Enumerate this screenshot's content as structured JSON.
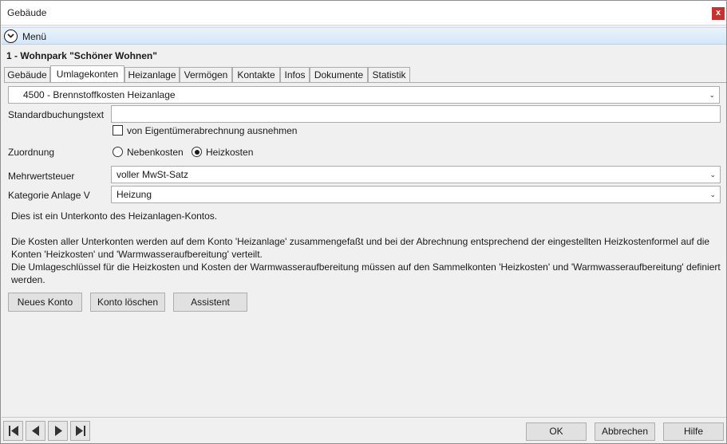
{
  "window": {
    "title": "Gebäude",
    "close_label": "x"
  },
  "menu": {
    "label": "Menü"
  },
  "record": {
    "title": "1 - Wohnpark \"Schöner Wohnen\""
  },
  "tabs": [
    {
      "label": "Gebäude"
    },
    {
      "label": "Umlagekonten"
    },
    {
      "label": "Heizanlage"
    },
    {
      "label": "Vermögen"
    },
    {
      "label": "Kontakte"
    },
    {
      "label": "Infos"
    },
    {
      "label": "Dokumente"
    },
    {
      "label": "Statistik"
    }
  ],
  "active_tab": "Umlagekonten",
  "form": {
    "account_select": "4500 - Brennstoffkosten Heizanlage",
    "standard_text_label": "Standardbuchungstext",
    "standard_text_value": "",
    "exclude_checkbox_label": "von Eigentümerabrechnung ausnehmen",
    "exclude_checked": false,
    "zuordnung_label": "Zuordnung",
    "radio_nebenkosten": "Nebenkosten",
    "radio_heizkosten": "Heizkosten",
    "zuordnung_selected": "Heizkosten",
    "mwst_label": "Mehrwertsteuer",
    "mwst_value": "voller MwSt-Satz",
    "kategorie_label": "Kategorie Anlage V",
    "kategorie_value": "Heizung"
  },
  "info": {
    "line1": "Dies ist ein Unterkonto des Heizanlagen-Kontos.",
    "line2": "Die Kosten aller Unterkonten werden auf dem Konto 'Heizanlage' zusammengefaßt und bei der Abrechnung entsprechend der eingestellten Heizkostenformel auf die",
    "line3": "Konten 'Heizkosten' und 'Warmwasseraufbereitung' verteilt.",
    "line4": "Die Umlageschlüssel für die Heizkosten und Kosten der Warmwasseraufbereitung müssen auf den Sammelkonten 'Heizkosten' und 'Warmwasseraufbereitung' definiert",
    "line5": "werden."
  },
  "actions": {
    "new_account": "Neues Konto",
    "delete_account": "Konto löschen",
    "assistant": "Assistent"
  },
  "footer": {
    "ok": "OK",
    "cancel": "Abbrechen",
    "help": "Hilfe"
  },
  "icons": {
    "menu": "chevron-down-circle-icon",
    "nav_first": "first-record-icon",
    "nav_prev": "previous-record-icon",
    "nav_next": "next-record-icon",
    "nav_last": "last-record-icon"
  },
  "colors": {
    "close_button": "#c8312f",
    "menubar": "#d3e6fa",
    "window_bg": "#f0f0f0"
  }
}
